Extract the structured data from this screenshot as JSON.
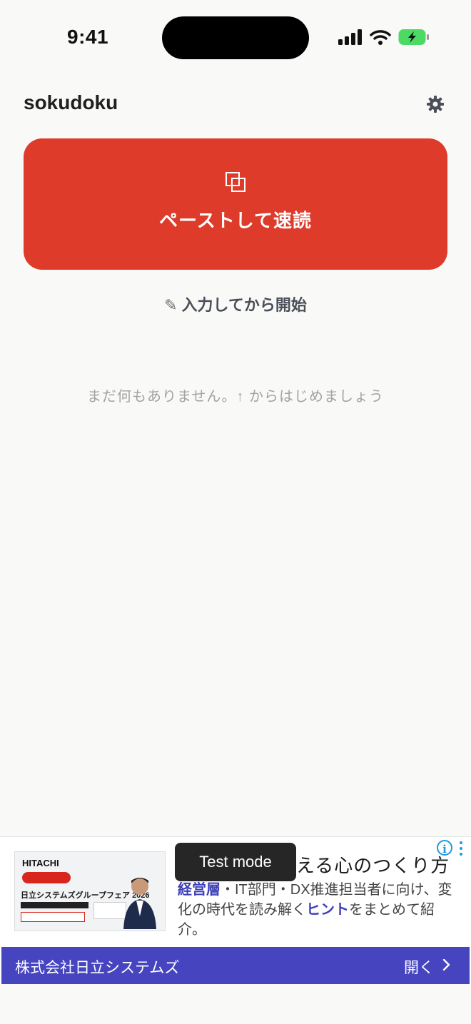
{
  "status_bar": {
    "time": "9:41"
  },
  "header": {
    "title": "sokudoku"
  },
  "paste_button": {
    "label": "ペーストして速読"
  },
  "input_start": {
    "label": "入力してから開始",
    "icon_glyph": "✎"
  },
  "empty_state": {
    "message": "まだ何もありません。↑ からはじめましょう"
  },
  "ad": {
    "test_mode_label": "Test mode",
    "headline": "える心のつくり方",
    "body_prefix": "",
    "body_bold1": "経営層",
    "body_mid": "・IT部門・DX推進担当者に向け、変化の時代を読み解く",
    "body_bold2": "ヒント",
    "body_suffix": "をまとめて紹介。",
    "image": {
      "brand": "HITACHI",
      "title": "日立システムズグループフェア 2026"
    },
    "advertiser": "株式会社日立システムズ",
    "open_label": "開く"
  },
  "colors": {
    "background": "#f9f9f7",
    "primary": "#de3b2b",
    "ad_bar": "#4744c0",
    "info": "#1a9be0"
  }
}
